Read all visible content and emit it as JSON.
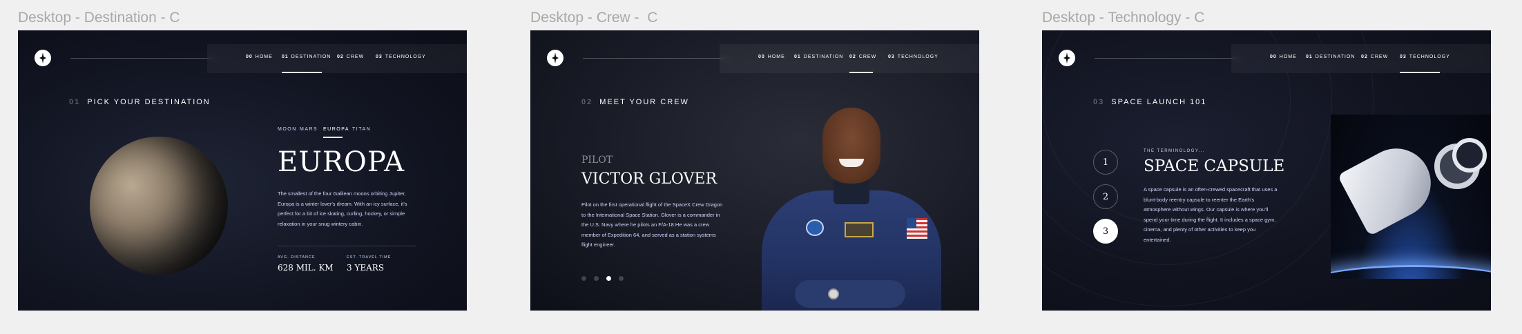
{
  "frames": [
    {
      "label": "Desktop - Destination - C",
      "nav": [
        {
          "num": "00",
          "label": "HOME"
        },
        {
          "num": "01",
          "label": "DESTINATION"
        },
        {
          "num": "02",
          "label": "CREW"
        },
        {
          "num": "03",
          "label": "TECHNOLOGY"
        }
      ],
      "active_nav_index": 1,
      "section": {
        "num": "01",
        "title": "PICK YOUR DESTINATION"
      },
      "planet_tabs": [
        "MOON",
        "MARS",
        "EUROPA",
        "TITAN"
      ],
      "active_tab_index": 2,
      "name": "EUROPA",
      "description": "The smallest of the four Galilean moons orbiting Jupiter, Europa is a winter lover's dream. With an icy surface, it's perfect for a bit of ice skating, curling, hockey, or simple relaxation in your snug wintery cabin.",
      "stats": [
        {
          "label": "AVG. DISTANCE",
          "value": "628 MIL. KM"
        },
        {
          "label": "EST. TRAVEL TIME",
          "value": "3 YEARS"
        }
      ]
    },
    {
      "label": "Desktop - Crew -  C",
      "nav": [
        {
          "num": "00",
          "label": "HOME"
        },
        {
          "num": "01",
          "label": "DESTINATION"
        },
        {
          "num": "02",
          "label": "CREW"
        },
        {
          "num": "03",
          "label": "TECHNOLOGY"
        }
      ],
      "active_nav_index": 2,
      "section": {
        "num": "02",
        "title": "MEET YOUR CREW"
      },
      "role": "PILOT",
      "name": "VICTOR GLOVER",
      "bio": "Pilot on the first operational flight of the SpaceX Crew Dragon to the International Space Station. Glover is a commander in the U.S. Navy where he pilots an F/A-18.He was a crew member of Expedition 64, and served as a station systems flight engineer.",
      "dot_count": 4,
      "active_dot_index": 2
    },
    {
      "label": "Desktop - Technology - C",
      "nav": [
        {
          "num": "00",
          "label": "HOME"
        },
        {
          "num": "01",
          "label": "DESTINATION"
        },
        {
          "num": "02",
          "label": "CREW"
        },
        {
          "num": "03",
          "label": "TECHNOLOGY"
        }
      ],
      "active_nav_index": 3,
      "section": {
        "num": "03",
        "title": "SPACE LAUNCH 101"
      },
      "steps": [
        "1",
        "2",
        "3"
      ],
      "active_step_index": 2,
      "kicker": "THE TERMINOLOGY...",
      "name": "SPACE CAPSULE",
      "description": "A space capsule is an often-crewed spacecraft that uses a blunt-body reentry capsule to reenter the Earth's atmosphere without wings. Our capsule is where you'll spend your time during the flight. It includes a space gym, cinema, and plenty of other activities to keep you entertained."
    }
  ],
  "colors": {
    "background": "#0b0d17",
    "secondary": "#d0d6f9",
    "canvas": "#f0f0f0",
    "label": "#a8a8a8"
  }
}
